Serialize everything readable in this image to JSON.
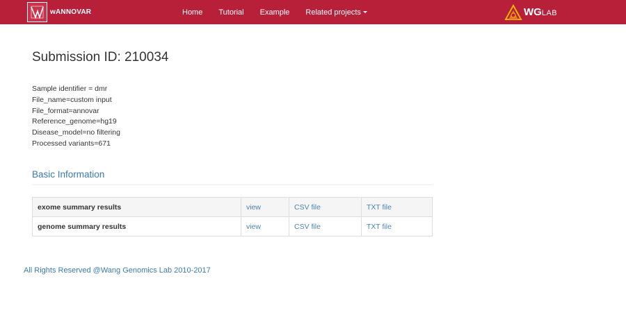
{
  "navbar": {
    "brand_text": "wANNOVAR",
    "links": [
      {
        "label": "Home"
      },
      {
        "label": "Tutorial"
      },
      {
        "label": "Example"
      },
      {
        "label": "Related projects"
      }
    ],
    "lab_logo_text_big": "WG",
    "lab_logo_text_small": "LAB"
  },
  "page": {
    "title": "Submission ID: 210034",
    "params": [
      "Sample identifier = dmr",
      "File_name=custom input",
      "File_format=annovar",
      "Reference_genome=hg19",
      "Disease_model=no filtering",
      "Processed variants=671"
    ]
  },
  "basic_info": {
    "title": "Basic Information",
    "rows": [
      {
        "name": "exome summary results",
        "view": "view",
        "csv": "CSV file",
        "txt": "TXT file"
      },
      {
        "name": "genome summary results",
        "view": "view",
        "csv": "CSV file",
        "txt": "TXT file"
      }
    ]
  },
  "footer": {
    "text": "All Rights Reserved @Wang Genomics Lab 2010-2017"
  },
  "colors": {
    "navbar": "#b8203a",
    "link": "#3a7ab0",
    "text": "#333333"
  }
}
